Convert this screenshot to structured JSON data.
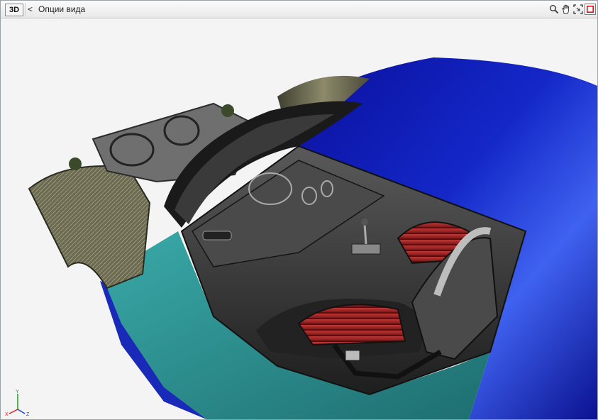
{
  "toolbar": {
    "mode_badge": "3D",
    "back_label": "<",
    "breadcrumb": "Опции вида",
    "tools": [
      {
        "name": "zoom-icon"
      },
      {
        "name": "pan-hand-icon"
      },
      {
        "name": "fit-view-icon"
      },
      {
        "name": "stop-icon"
      }
    ]
  },
  "axes": {
    "x_label": "X",
    "y_label": "Y",
    "z_label": "Z",
    "colors": {
      "x": "#e02020",
      "y": "#20a020",
      "z": "#2040e0"
    }
  },
  "scene": {
    "description_icon": "car-3d-model"
  }
}
